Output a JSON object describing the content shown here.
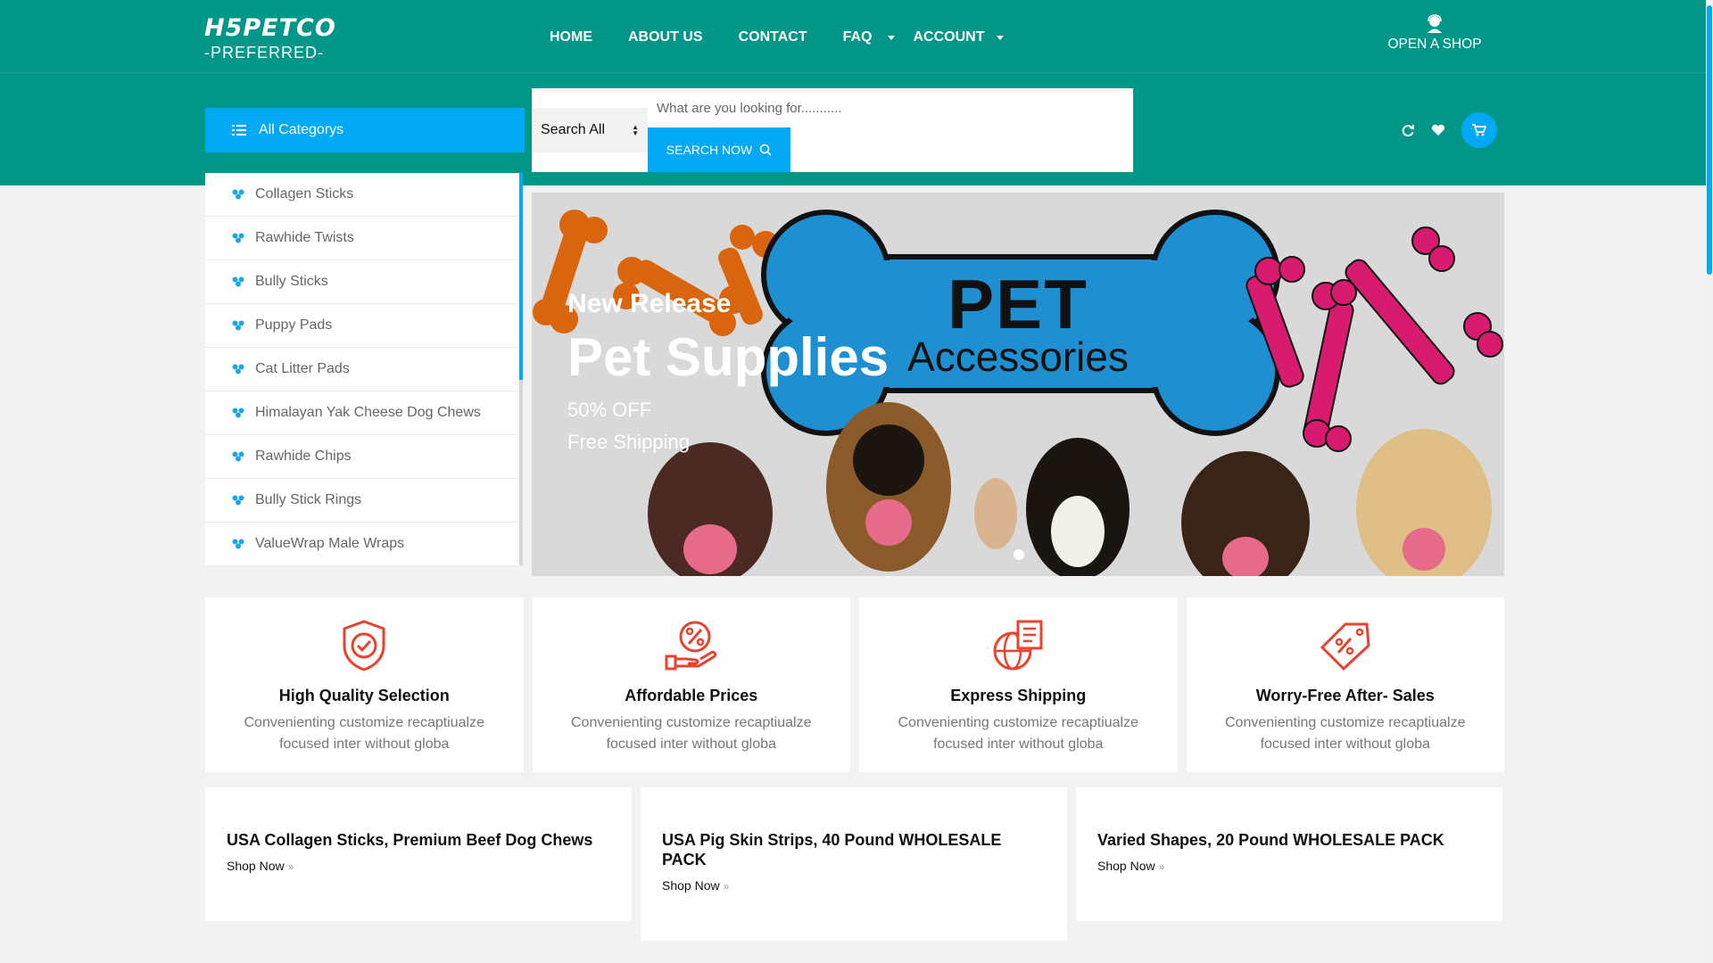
{
  "brand": {
    "name": "H5PETCO",
    "tagline": "-PREFERRED-"
  },
  "nav": {
    "home": "HOME",
    "about": "ABOUT US",
    "contact": "CONTACT",
    "faq": "FAQ",
    "account": "ACCOUNT"
  },
  "open_shop": {
    "label": "OPEN A SHOP",
    "icon": "user-icon"
  },
  "categories_button": {
    "label": "All Categorys",
    "icon": "list-icon"
  },
  "search": {
    "scope": "Search All",
    "placeholder": "What are you looking for...........",
    "button": "SEARCH NOW",
    "button_icon": "search-icon"
  },
  "header_icons": [
    "refresh-icon",
    "heart-icon",
    "cart-icon"
  ],
  "categories": [
    "Collagen Sticks",
    "Rawhide Twists",
    "Bully Sticks",
    "Puppy Pads",
    "Cat Litter Pads",
    "Himalayan Yak Cheese Dog Chews",
    "Rawhide Chips",
    "Bully Stick Rings",
    "ValueWrap Male Wraps"
  ],
  "banner": {
    "kicker": "New Release",
    "headline": "Pet Supplies",
    "line1": "50% OFF",
    "line2": "Free Shipping",
    "art_title": "PET",
    "art_subtitle": "Accessories"
  },
  "features": [
    {
      "icon": "shield-check-icon",
      "title": "High Quality Selection",
      "text": "Convenienting customize recaptiualze focused inter without globa"
    },
    {
      "icon": "hand-percent-icon",
      "title": "Affordable Prices",
      "text": "Convenienting customize recaptiualze focused inter without globa"
    },
    {
      "icon": "globe-box-icon",
      "title": "Express Shipping",
      "text": "Convenienting customize recaptiualze focused inter without globa"
    },
    {
      "icon": "tag-percent-icon",
      "title": "Worry-Free After- Sales",
      "text": "Convenienting customize recaptiualze focused inter without globa"
    }
  ],
  "promos": [
    {
      "title": "USA Collagen Sticks, Premium Beef Dog Chews",
      "link": "Shop Now"
    },
    {
      "title": "USA Pig Skin Strips, 40 Pound WHOLESALE PACK",
      "link": "Shop Now"
    },
    {
      "title": "Varied Shapes, 20 Pound WHOLESALE PACK",
      "link": "Shop Now"
    }
  ],
  "colors": {
    "header": "#009688",
    "accent": "#03a9f4",
    "icon_red": "#e8432e",
    "bone_blue": "#1e8fd0",
    "bone_pink": "#d81b6f",
    "bone_orange": "#d9660e"
  }
}
